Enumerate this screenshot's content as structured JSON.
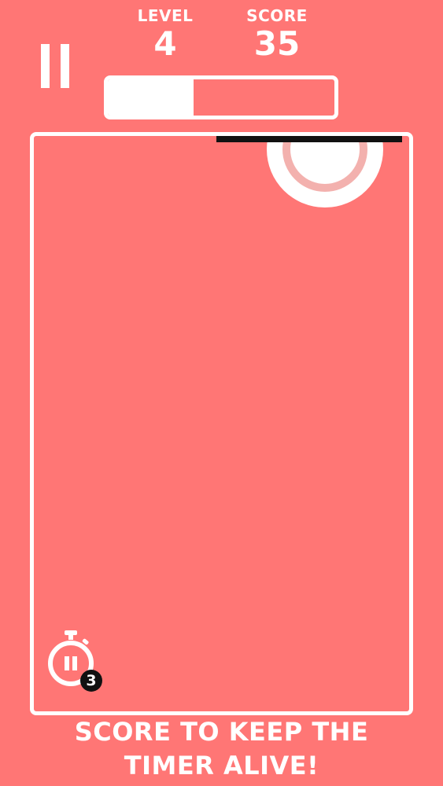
{
  "hud": {
    "level_label": "LEVEL",
    "level_value": "4",
    "score_label": "SCORE",
    "score_value": "35",
    "timer_fraction": 0.38,
    "pause_icon": "pause-icon"
  },
  "arena": {
    "paddle_color": "#111111",
    "ball_color": "#ffffff",
    "ball_ring_color": "#f3b1ae"
  },
  "powerup": {
    "icon": "stopwatch-pause-icon",
    "count": "3"
  },
  "hint": {
    "line1": "SCORE TO KEEP THE",
    "line2": "TIMER ALIVE!"
  },
  "colors": {
    "background": "#ff7675",
    "foreground": "#ffffff"
  }
}
